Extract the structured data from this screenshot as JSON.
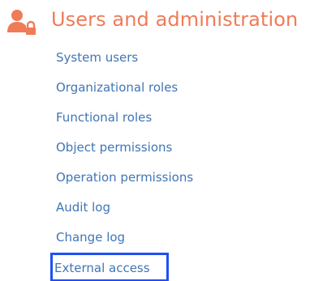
{
  "section": {
    "title": "Users and administration",
    "icon": "user-lock-icon",
    "title_color": "#f07b57"
  },
  "links": [
    {
      "label": "System users"
    },
    {
      "label": "Organizational roles"
    },
    {
      "label": "Functional roles"
    },
    {
      "label": "Object permissions"
    },
    {
      "label": "Operation permissions"
    },
    {
      "label": "Audit log"
    },
    {
      "label": "Change log"
    },
    {
      "label": "External access",
      "highlighted": true
    }
  ],
  "colors": {
    "link": "#3f76b5",
    "highlight_border": "#1f4ff5"
  }
}
